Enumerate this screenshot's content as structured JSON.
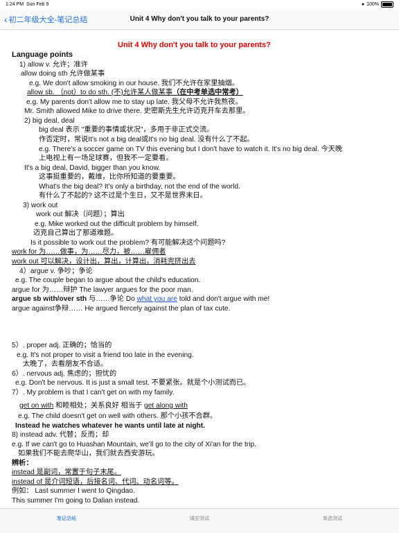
{
  "status": {
    "time": "1:24 PM",
    "date": "Sun Feb 9",
    "battery": "100%"
  },
  "nav": {
    "back_label": "初二年级大全-笔记总结",
    "title": "Unit 4 Why don't you talk to your parents?"
  },
  "article": {
    "title": "Unit 4 Why don't you talk to your parents?",
    "l01": "Language points",
    "l02": "1) allow v. 允许；准许",
    "l03": "allow doing sth 允许做某事",
    "l04": "e.g. We don't allow smoking in our house.  我们不允许在家里抽烟。",
    "l05a": "allow sb. （not）to do sth. (不)允许某人做某事",
    "l05b": "（在中考单选中常考）",
    "l06": "e.g. My parents don't allow me to stay up late.  我父母不允许我熬夜。",
    "l07": "Mr. Smith allowed Mike to drive there. 史密斯先生允许迈克开车去那里。",
    "l08": "2) big deal, deal",
    "l09": "big deal 表示 \"重要的事情或状况\"，多用于非正式交流。",
    "l10": "作否定时，常说It's not a big deal或It's no big deal. 没有什么了不起。",
    "l11": "e.g. There's a soccer game on TV this evening but I don't have to watch it. It's no big deal. 今天晚",
    "l12": "上电视上有一场足球赛，但我不一定要看。",
    "l13": "It's a big deal, David, bigger than you know.",
    "l14": "这事挺重要的，戴维，比你所知道的要重要。",
    "l15": "What's the big deal? It's only a birthday, not the end of the world.",
    "l16": "有什么了不起的? 这不过是个生日，又不是世界末日。",
    "l17": "3) work out",
    "l18": "work out   解决（问题）；算出",
    "l19": "e.g. Mike worked out the difficult problem by himself.",
    "l20": "迈克自己算出了那道难题。",
    "l21": "Is it possible to work out the problem? 有可能解决这个问题吗?",
    "l22": "work for 为……做事，为……尽力，被……雇佣者",
    "l23": "work out 可以解决，设计出，算出，计算出，消耗完挤出去",
    "l24": "4）argue v. 争吵；争论",
    "l25": "e.g. The couple began to argue about the child's education.",
    "l26": "argue for 为……辩护   The lawyer argues for the poor man.",
    "l27a": "argue sb  with/over sth",
    "l27b": " 与……争论  Do ",
    "l27c": "what you are",
    "l27d": " told and don't argue with me!",
    "l28": "argue against争辩……  He argued fiercely against the plan of tax cute.",
    "l29": "5）. proper adj. 正确的；恰当的",
    "l30": "e.g. It's not proper to visit a friend too late in the evening.",
    "l31": "太晚了，去看朋友不合适。",
    "l32": "6）. nervous adj. 焦虑的；担忧的",
    "l33": "e.g. Don't be nervous. It is just a small test. 不要紧张。就是个小测试而已。",
    "l34": "7）. My problem is that I can't get on with my family.",
    "l35a": "get on with",
    "l35b": "  和睦相处；关系良好  相当于 ",
    "l35c": "get along with",
    "l36": "e.g. The child doesn't get on well with others. 那个小孩不合群。",
    "l37": "Instead he watches whatever he wants until late at night.",
    "l38": "8) instead adv. 代替；反而；却",
    "l39": "e.g. If we can't go to Huashan Mountain, we'll go to the city of Xi'an for the trip.",
    "l40": "如果我们不能去爬华山，我们就去西安游玩。",
    "l41": "辨析：",
    "l42": "instead 是副词，常置于句子末尾。",
    "l43": "instead of 是介词短语，后接名词、代词、动名词等。",
    "l44": "例如：  Last summer I went to Qingdao.",
    "l45": "This summer I'm going to Dalian instead."
  },
  "tabs": [
    "笔记总结",
    "填空测试",
    "单选测试"
  ],
  "colors": {
    "accent": "#1f6fe0",
    "title_red": "#e00000"
  }
}
